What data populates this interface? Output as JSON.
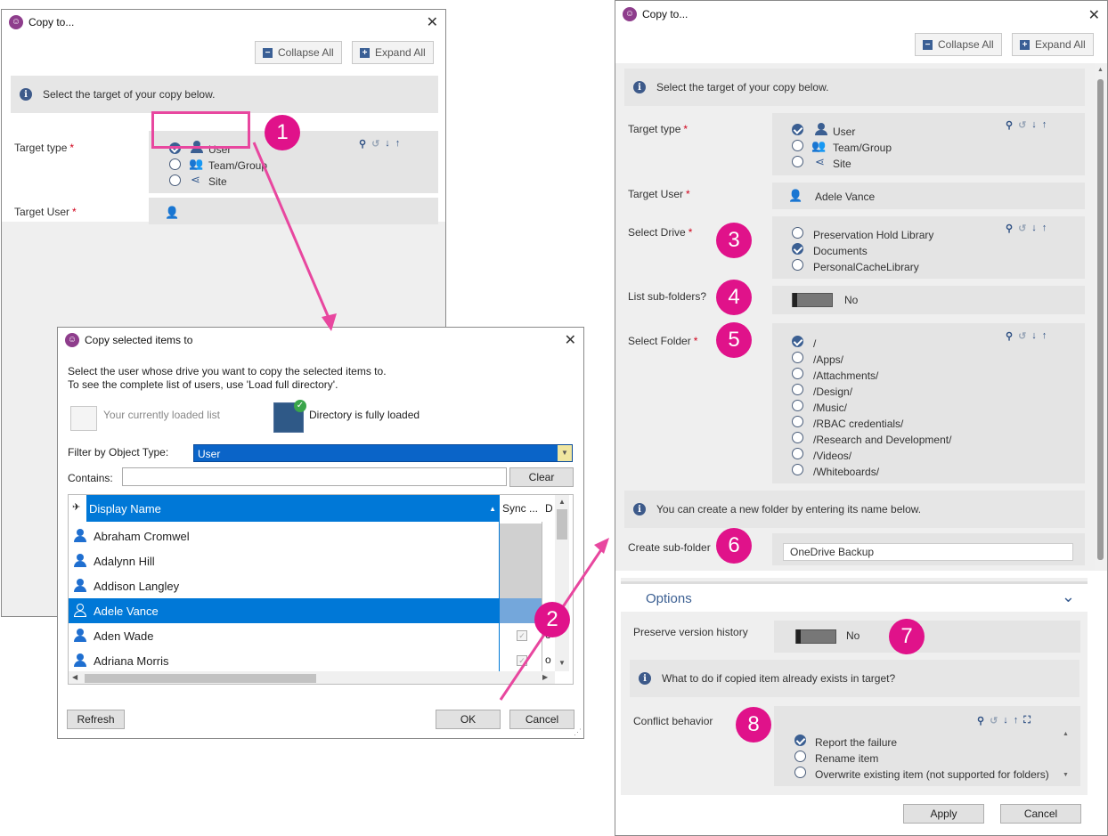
{
  "left_dialog": {
    "title": "Copy to...",
    "collapse_all": "Collapse All",
    "expand_all": "Expand All",
    "info": "Select the target of your copy below.",
    "target_type_label": "Target type",
    "target_options": [
      "User",
      "Team/Group",
      "Site"
    ],
    "target_user_label": "Target User",
    "required": "*"
  },
  "popup": {
    "title": "Copy selected items to",
    "instructions_line1": "Select the user whose drive you want to copy the selected items to.",
    "instructions_line2": "To see the complete list of users, use 'Load full directory'.",
    "loaded_list": "Your currently loaded list",
    "directory_loaded": "Directory is fully loaded",
    "filter_label": "Filter by Object Type:",
    "filter_value": "User",
    "contains_label": "Contains:",
    "contains_value": "",
    "clear_button": "Clear",
    "columns": [
      "Display Name",
      "Sync ...",
      "D"
    ],
    "rows": [
      {
        "name": "Abraham Cromwel",
        "selected": false
      },
      {
        "name": "Adalynn Hill",
        "selected": false
      },
      {
        "name": "Addison Langley",
        "selected": false
      },
      {
        "name": "Adele Vance",
        "selected": true
      },
      {
        "name": "Aden Wade",
        "selected": false,
        "tail": "o"
      },
      {
        "name": "Adriana Morris",
        "selected": false,
        "tail": "o"
      }
    ],
    "refresh_button": "Refresh",
    "ok_button": "OK",
    "cancel_button": "Cancel"
  },
  "right_dialog": {
    "title": "Copy to...",
    "collapse_all": "Collapse All",
    "expand_all": "Expand All",
    "info": "Select the target of your copy below.",
    "target_type_label": "Target type",
    "target_options": [
      "User",
      "Team/Group",
      "Site"
    ],
    "target_user_label": "Target User",
    "target_user_value": "Adele Vance",
    "select_drive_label": "Select Drive",
    "drive_options": [
      "Preservation Hold Library",
      "Documents",
      "PersonalCacheLibrary"
    ],
    "list_subfolders_label": "List sub-folders?",
    "list_subfolders_value": "No",
    "select_folder_label": "Select Folder",
    "folders": [
      "/",
      "/Apps/",
      "/Attachments/",
      "/Design/",
      "/Music/",
      "/RBAC credentials/",
      "/Research and Development/",
      "/Videos/",
      "/Whiteboards/"
    ],
    "new_folder_info": "You can create a new folder by entering its name below.",
    "create_subfolder_label": "Create sub-folder",
    "create_subfolder_value": "OneDrive Backup",
    "options_header": "Options",
    "preserve_label": "Preserve version history",
    "preserve_value": "No",
    "conflict_info": "What to do if copied item already exists in target?",
    "conflict_label": "Conflict behavior",
    "conflict_options": [
      "Report the failure",
      "Rename item",
      "Overwrite existing item (not supported for folders)"
    ],
    "apply_button": "Apply",
    "cancel_button": "Cancel",
    "required": "*"
  },
  "badges": [
    "1",
    "2",
    "3",
    "4",
    "5",
    "6",
    "7",
    "8"
  ],
  "colors": {
    "accent": "#0078d7",
    "badge": "#e0128a",
    "brand": "#8e3d8c",
    "icon_blue": "#3b5f92"
  }
}
